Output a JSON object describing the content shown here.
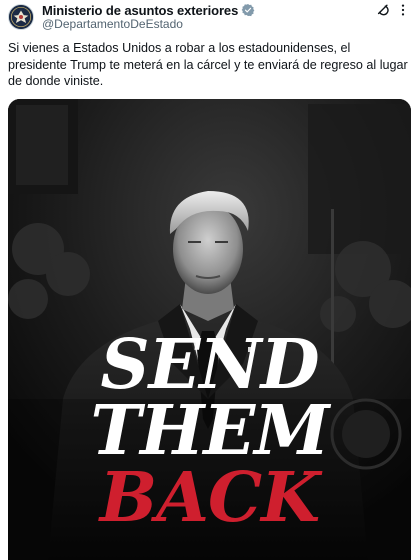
{
  "tweet": {
    "author": {
      "display_name": "Ministerio de asuntos exteriores",
      "handle": "@DepartamentoDeEstado",
      "verified_icon": "verified-badge-icon",
      "avatar_icon": "state-department-seal-icon"
    },
    "actions": {
      "grok_icon": "grok-icon",
      "more_icon": "more-options-icon"
    },
    "text": "Si vienes a Estados Unidos a robar a los estadounidenses, el presidente Trump te meterá en la cárcel y te enviará de regreso al lugar de donde viniste.",
    "media": {
      "headline_line1": "SEND",
      "headline_line2": "THEM",
      "headline_line3": "BACK"
    }
  },
  "colors": {
    "accent_red": "#cf1f2e",
    "verified_blue": "#1d9bf0",
    "handle_gray": "#536471"
  }
}
